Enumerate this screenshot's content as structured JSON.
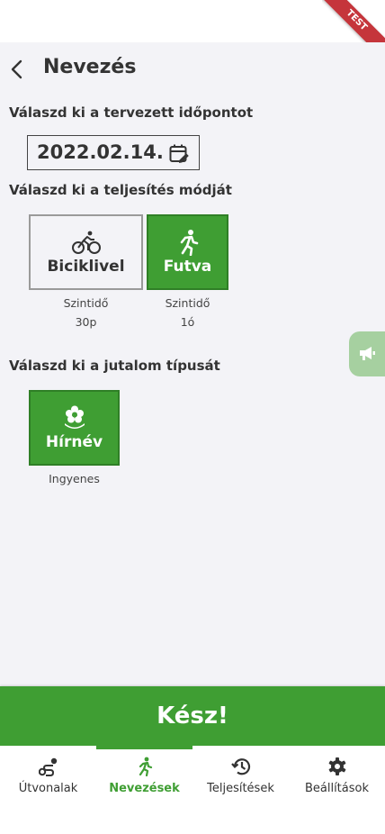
{
  "ribbon": "TEST",
  "header": {
    "title": "Nevezés"
  },
  "date_section": {
    "label": "Válaszd ki a tervezett időpontot",
    "value": "2022.02.14."
  },
  "mode_section": {
    "label": "Válaszd ki a teljesítés módját",
    "options": [
      {
        "label": "Biciklivel",
        "caption_line1": "Szintidő",
        "caption_line2": "30p",
        "selected": false
      },
      {
        "label": "Futva",
        "caption_line1": "Szintidő",
        "caption_line2": "1ó",
        "selected": true
      }
    ]
  },
  "reward_section": {
    "label": "Válaszd ki a jutalom típusát",
    "options": [
      {
        "label": "Hírnév",
        "caption": "Ingyenes",
        "selected": true
      }
    ]
  },
  "done_button": "Kész!",
  "bottom_nav": [
    {
      "label": "Útvonalak",
      "icon": "route-icon",
      "active": false
    },
    {
      "label": "Nevezések",
      "icon": "running-icon",
      "active": true
    },
    {
      "label": "Teljesítések",
      "icon": "history-icon",
      "active": false
    },
    {
      "label": "Beállítások",
      "icon": "gear-icon",
      "active": false
    }
  ],
  "colors": {
    "accent": "#3f9e33",
    "background": "#f3f3f7",
    "ribbon": "#c5353b"
  }
}
